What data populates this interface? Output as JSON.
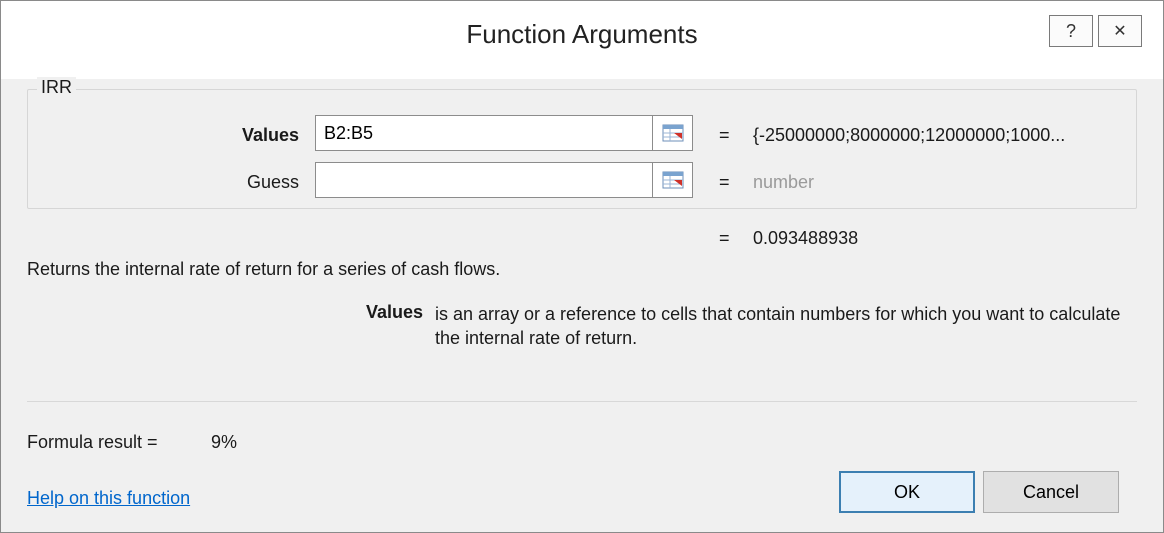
{
  "window": {
    "title": "Function Arguments",
    "help_glyph": "?",
    "close_glyph": "✕"
  },
  "function": {
    "name": "IRR",
    "args": [
      {
        "label": "Values",
        "input": "B2:B5",
        "equals": "=",
        "result": "{-25000000;8000000;12000000;1000..."
      },
      {
        "label": "Guess",
        "input": "",
        "equals": "=",
        "result": "number"
      }
    ],
    "overall_equals": "=",
    "overall_result": "0.093488938",
    "description": "Returns the internal rate of return for a series of cash flows.",
    "param_name": "Values",
    "param_description": "is an array or a reference to cells that contain numbers for which you want to calculate the internal rate of return."
  },
  "footer": {
    "result_label": "Formula result =",
    "result_value": "9%",
    "help_link": "Help on this function",
    "ok_label": "OK",
    "cancel_label": "Cancel"
  },
  "icons": {
    "collapse": "range-select-icon"
  }
}
